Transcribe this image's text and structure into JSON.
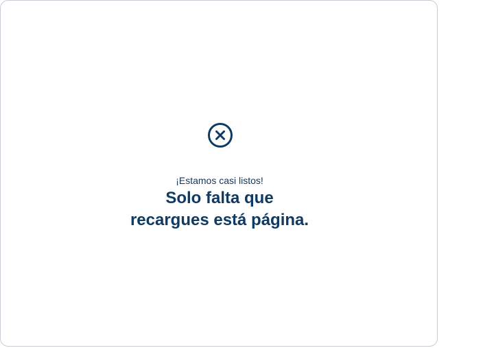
{
  "dialog": {
    "icon": "close-circle-icon",
    "subtitle": "¡Estamos casi listos!",
    "title_line1": "Solo falta que",
    "title_line2": "recargues está página."
  },
  "colors": {
    "primary": "#0f3a63",
    "border": "#c6ccd6",
    "background": "#ffffff"
  }
}
